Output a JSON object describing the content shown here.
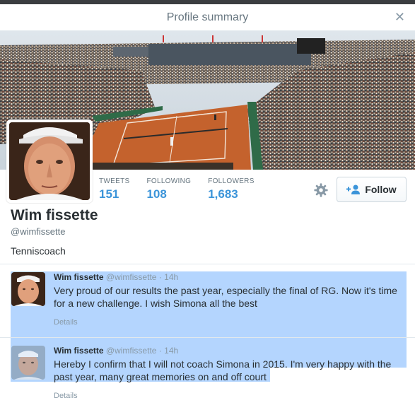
{
  "modal": {
    "title": "Profile summary",
    "close_icon": "close-icon"
  },
  "profile": {
    "name": "Wim fissette",
    "handle": "@wimfissette",
    "bio": "Tenniscoach",
    "stats": [
      {
        "label": "TWEETS",
        "value": "151"
      },
      {
        "label": "FOLLOWING",
        "value": "108"
      },
      {
        "label": "FOLLOWERS",
        "value": "1,683"
      }
    ],
    "follow_label": "Follow",
    "follow_icon": "add-person-icon",
    "settings_icon": "gear-icon",
    "banner_image": "tennis-stadium-clay-court",
    "colors": {
      "accent": "#3b94d9",
      "selection": "#b4d5fe",
      "clay": "#c4622d"
    }
  },
  "tweets": [
    {
      "name": "Wim fissette",
      "handle": "@wimfissette",
      "separator": "·",
      "time": "14h",
      "line1": "Very proud of our results the past year, especially the final of RG. Now it's time",
      "line2": "for a new challenge. I wish Simona all the best",
      "details": "Details"
    },
    {
      "name": "Wim fissette",
      "handle": "@wimfissette",
      "separator": "·",
      "time": "14h",
      "line1": "Hereby I confirm that I will not coach Simona in 2015. I'm very happy with the",
      "line2": "past year, many great memories on and off court",
      "details": "Details"
    }
  ]
}
